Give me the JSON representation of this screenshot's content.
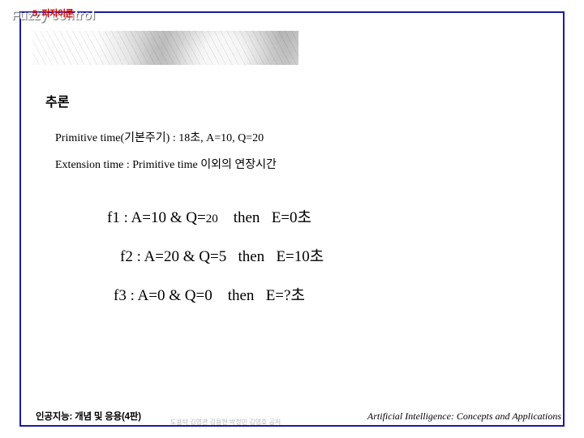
{
  "slide": {
    "header_tag": "5. 퍼지이론",
    "title": "Fuzzy control",
    "section_heading": "추론",
    "bullets": [
      "Primitive time(기본주기) : 18초,  A=10, Q=20",
      "Extension time : Primitive time 이외의 연장시간"
    ],
    "rules": [
      {
        "name": "f1",
        "cond_a": ": A=10  &  Q=",
        "cond_q_small": "20",
        "then": "then",
        "result": "E=0초"
      },
      {
        "name": "f2",
        "cond_a": ": A=20  &  Q=5",
        "cond_q_small": "",
        "then": "then",
        "result": "E=10초"
      },
      {
        "name": "f3",
        "cond_a": ": A=0  &  Q=0",
        "cond_q_small": "",
        "then": "then",
        "result": "E=?초"
      }
    ],
    "footer": {
      "left": "인공지능: 개념 및 응용(4판)",
      "center": "도용탁 김영관 김용현 박정민 김영호 공저",
      "right": "Artificial Intelligence: Concepts and Applications"
    },
    "colors": {
      "frame": "#1a1aa8",
      "header_tag": "#d00000",
      "title_text": "#ffffff"
    }
  }
}
